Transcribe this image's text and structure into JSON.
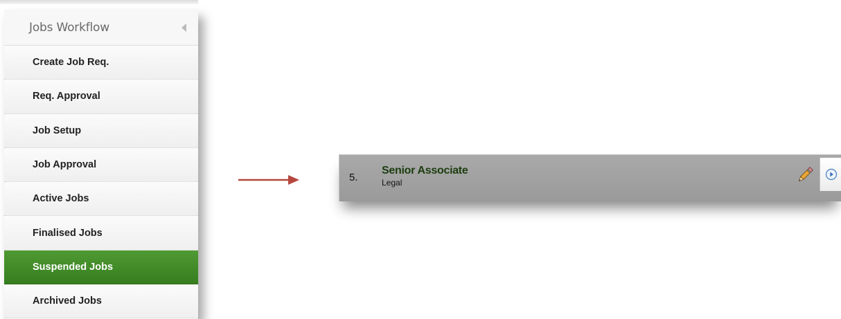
{
  "sidebar": {
    "title": "Jobs Workflow",
    "collapse_icon": "triangle-left-icon",
    "items": [
      {
        "label": "Create Job Req.",
        "active": false
      },
      {
        "label": "Req. Approval",
        "active": false
      },
      {
        "label": "Job Setup",
        "active": false
      },
      {
        "label": "Job Approval",
        "active": false
      },
      {
        "label": "Active Jobs",
        "active": false
      },
      {
        "label": "Finalised Jobs",
        "active": false
      },
      {
        "label": "Suspended Jobs",
        "active": true
      },
      {
        "label": "Archived Jobs",
        "active": false
      }
    ],
    "active_color": "#3f8a27"
  },
  "arrow": {
    "icon": "right-arrow-icon",
    "color": "#b5473f"
  },
  "job": {
    "number": "5.",
    "title": "Senior Associate",
    "department": "Legal",
    "edit_icon": "pencil-icon",
    "view_icon": "circle-play-icon",
    "title_color": "#1c3d0f",
    "row_color": "#a3a3a3"
  }
}
